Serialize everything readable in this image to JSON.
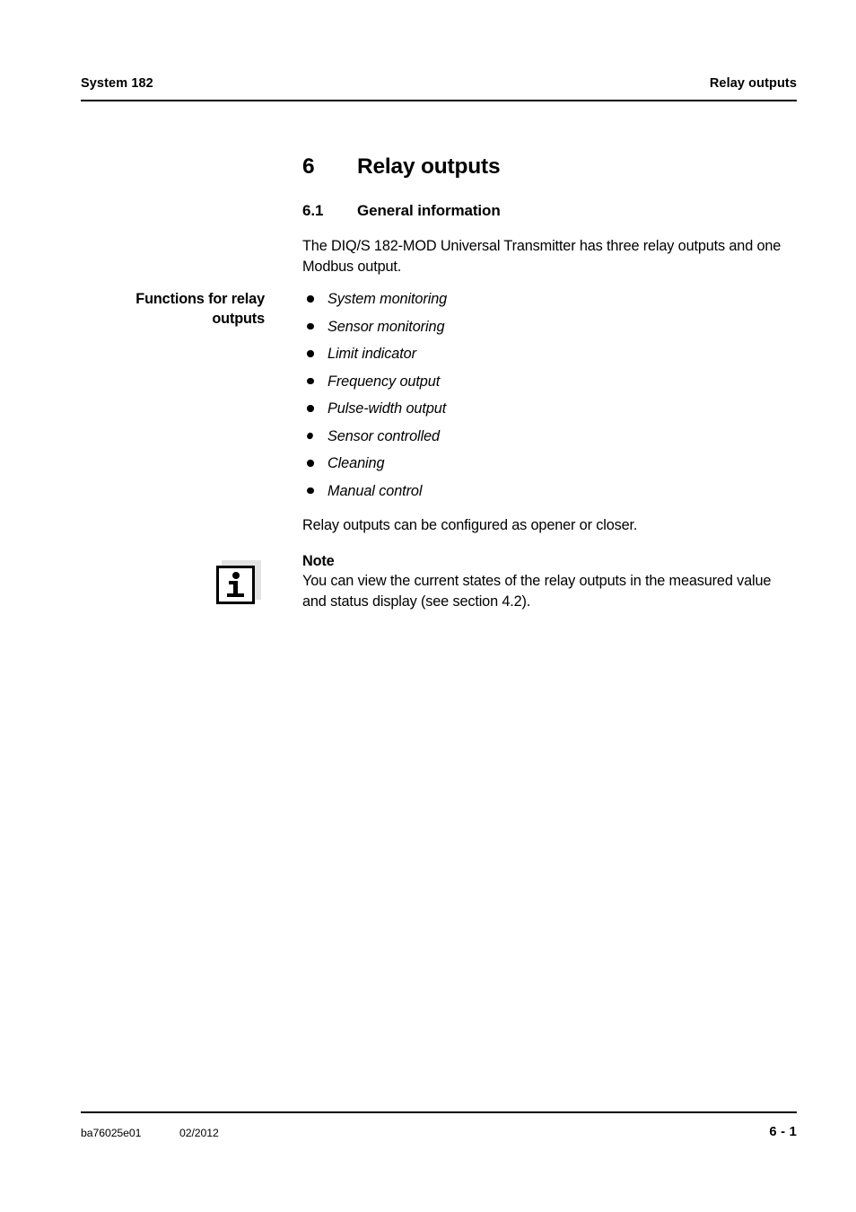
{
  "header": {
    "left_text": "System 182",
    "right_text": "Relay outputs"
  },
  "chapter": {
    "number": "6",
    "title": "Relay outputs"
  },
  "section": {
    "number": "6.1",
    "title": "General information"
  },
  "intro_paragraph": "The DIQ/S 182-MOD Universal Transmitter has three relay outputs and one Modbus output.",
  "margin_note_label": "Functions for relay outputs",
  "functions_list": [
    "System monitoring",
    "Sensor monitoring",
    "Limit indicator",
    "Frequency output",
    "Pulse-width output",
    "Sensor controlled",
    "Cleaning",
    "Manual control"
  ],
  "config_paragraph": "Relay outputs can be configured as opener or closer.",
  "note": {
    "icon": "info-i-icon",
    "title": "Note",
    "body": "You can view the current states of the relay outputs in the measured value and status display (see section 4.2)."
  },
  "footer": {
    "document_id": "ba76025e01",
    "date": "02/2012",
    "page_number": "6 - 1"
  },
  "colors": {
    "text": "#000000",
    "page_background": "#ffffff",
    "icon_shadow": "#e3e3e3"
  }
}
